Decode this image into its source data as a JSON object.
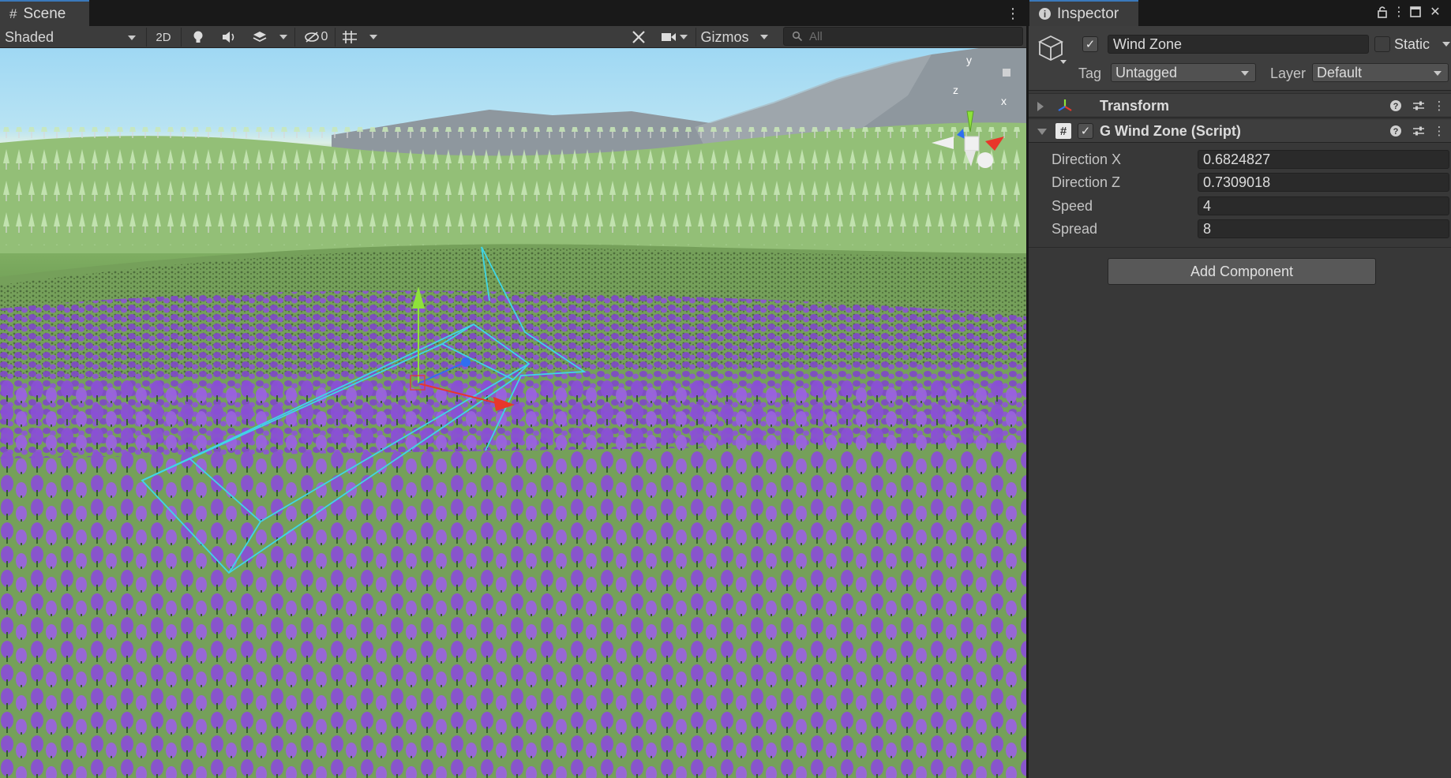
{
  "scene": {
    "tab_label": "Scene",
    "shading_mode": "Shaded",
    "mode_2d_label": "2D",
    "hidden_count": "0",
    "gizmos_label": "Gizmos",
    "search_placeholder": "All",
    "axis_labels": {
      "y": "y",
      "x": "x",
      "z": "z"
    }
  },
  "inspector": {
    "tab_label": "Inspector",
    "object": {
      "name": "Wind Zone",
      "active": true,
      "static_label": "Static",
      "static_checked": false,
      "tag_label": "Tag",
      "tag_value": "Untagged",
      "layer_label": "Layer",
      "layer_value": "Default"
    },
    "components": [
      {
        "title": "Transform",
        "expanded": false
      },
      {
        "title": "G Wind Zone (Script)",
        "expanded": true,
        "enabled": true
      }
    ],
    "properties": [
      {
        "label": "Direction X",
        "value": "0.6824827"
      },
      {
        "label": "Direction Z",
        "value": "0.7309018"
      },
      {
        "label": "Speed",
        "value": "4"
      },
      {
        "label": "Spread",
        "value": "8"
      }
    ],
    "add_component_label": "Add Component"
  },
  "colors": {
    "accent_tab": "#3a79bb",
    "lavender": "#8a4fd6",
    "gizmo_outline": "#3fd6e6",
    "axis_x": "#e8372a",
    "axis_y": "#8ee23b",
    "axis_z": "#2f6ff0"
  }
}
